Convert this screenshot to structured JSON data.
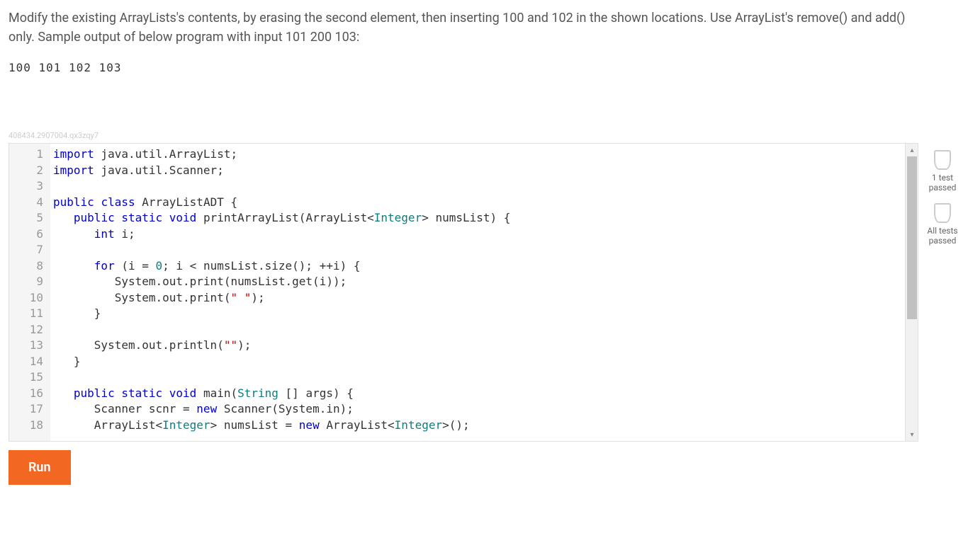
{
  "prompt": "Modify the existing ArrayLists's contents, by erasing the second element, then inserting 100 and 102 in the shown locations. Use ArrayList's remove() and add() only. Sample output of below program with input 101 200 103:",
  "sample_output": "100 101 102 103",
  "watermark": "408434.2907004.qx3zqy7",
  "code_lines": [
    {
      "n": "1",
      "tokens": [
        [
          "kw",
          "import"
        ],
        [
          "",
          " java.util.ArrayList;"
        ]
      ]
    },
    {
      "n": "2",
      "tokens": [
        [
          "kw",
          "import"
        ],
        [
          "",
          " java.util.Scanner;"
        ]
      ]
    },
    {
      "n": "3",
      "tokens": [
        [
          "",
          ""
        ]
      ]
    },
    {
      "n": "4",
      "tokens": [
        [
          "kw",
          "public"
        ],
        [
          "",
          " "
        ],
        [
          "kw",
          "class"
        ],
        [
          "",
          " ArrayListADT {"
        ]
      ]
    },
    {
      "n": "5",
      "tokens": [
        [
          "",
          "   "
        ],
        [
          "kw",
          "public"
        ],
        [
          "",
          " "
        ],
        [
          "kw",
          "static"
        ],
        [
          "",
          " "
        ],
        [
          "kw",
          "void"
        ],
        [
          "",
          " printArrayList(ArrayList<"
        ],
        [
          "type",
          "Integer"
        ],
        [
          "",
          "> numsList) {"
        ]
      ]
    },
    {
      "n": "6",
      "tokens": [
        [
          "",
          "      "
        ],
        [
          "kw",
          "int"
        ],
        [
          "",
          " i;"
        ]
      ]
    },
    {
      "n": "7",
      "tokens": [
        [
          "",
          ""
        ]
      ]
    },
    {
      "n": "8",
      "tokens": [
        [
          "",
          "      "
        ],
        [
          "kw",
          "for"
        ],
        [
          "",
          " (i = "
        ],
        [
          "num",
          "0"
        ],
        [
          "",
          "; i < numsList.size(); ++i) {"
        ]
      ]
    },
    {
      "n": "9",
      "tokens": [
        [
          "",
          "         System.out.print(numsList.get(i));"
        ]
      ]
    },
    {
      "n": "10",
      "tokens": [
        [
          "",
          "         System.out.print("
        ],
        [
          "str",
          "\" \""
        ],
        [
          "",
          ");"
        ]
      ]
    },
    {
      "n": "11",
      "tokens": [
        [
          "",
          "      }"
        ]
      ]
    },
    {
      "n": "12",
      "tokens": [
        [
          "",
          ""
        ]
      ]
    },
    {
      "n": "13",
      "tokens": [
        [
          "",
          "      System.out.println("
        ],
        [
          "str",
          "\"\""
        ],
        [
          "",
          ");"
        ]
      ]
    },
    {
      "n": "14",
      "tokens": [
        [
          "",
          "   }"
        ]
      ]
    },
    {
      "n": "15",
      "tokens": [
        [
          "",
          ""
        ]
      ]
    },
    {
      "n": "16",
      "tokens": [
        [
          "",
          "   "
        ],
        [
          "kw",
          "public"
        ],
        [
          "",
          " "
        ],
        [
          "kw",
          "static"
        ],
        [
          "",
          " "
        ],
        [
          "kw",
          "void"
        ],
        [
          "",
          " main("
        ],
        [
          "type",
          "String"
        ],
        [
          "",
          " [] args) {"
        ]
      ]
    },
    {
      "n": "17",
      "tokens": [
        [
          "",
          "      Scanner scnr = "
        ],
        [
          "kw",
          "new"
        ],
        [
          "",
          " Scanner(System.in);"
        ]
      ]
    },
    {
      "n": "18",
      "tokens": [
        [
          "",
          "      ArrayList<"
        ],
        [
          "type",
          "Integer"
        ],
        [
          "",
          "> numsList = "
        ],
        [
          "kw",
          "new"
        ],
        [
          "",
          " ArrayList<"
        ],
        [
          "type",
          "Integer"
        ],
        [
          "",
          ">();"
        ]
      ]
    }
  ],
  "status": {
    "one_test": "1 test\npassed",
    "all_tests": "All tests\npassed"
  },
  "run_label": "Run"
}
